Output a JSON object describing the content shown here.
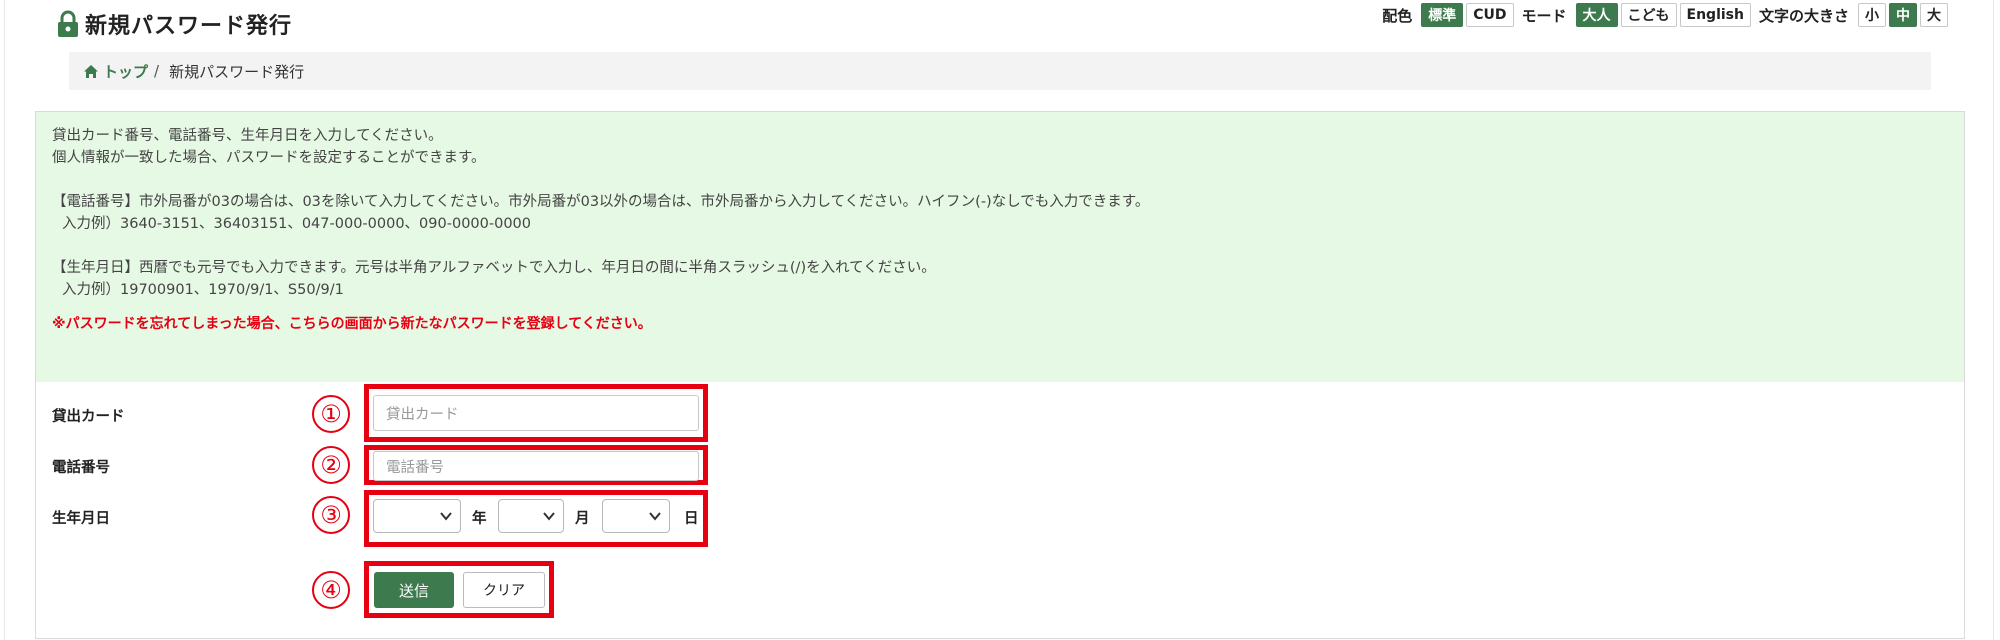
{
  "header": {
    "title": "新規パスワード発行",
    "color_label": "配色",
    "color_options": [
      "標準",
      "CUD"
    ],
    "mode_label": "モード",
    "mode_options": [
      "大人",
      "こども",
      "English"
    ],
    "size_label": "文字の大きさ",
    "size_options": [
      "小",
      "中",
      "大"
    ],
    "active": {
      "color": "標準",
      "mode": "大人",
      "size": "中"
    }
  },
  "breadcrumb": {
    "home": "トップ",
    "separator": "/",
    "current": "新規パスワード発行"
  },
  "notice": {
    "line1": "貸出カード番号、電話番号、生年月日を入力してください。",
    "line2": "個人情報が一致した場合、パスワードを設定することができます。",
    "phone_rule": "【電話番号】市外局番が03の場合は、03を除いて入力してください。市外局番が03以外の場合は、市外局番から入力してください。ハイフン(-)なしでも入力できます。",
    "phone_example": "入力例）3640-3151、36403151、047-000-0000、090-0000-0000",
    "birth_rule": "【生年月日】西暦でも元号でも入力できます。元号は半角アルファベットで入力し、年月日の間に半角スラッシュ(/)を入れてください。",
    "birth_example": "入力例）19700901、1970/9/1、S50/9/1",
    "warning": "※パスワードを忘れてしまった場合、こちらの画面から新たなパスワードを登録してください。"
  },
  "form": {
    "card_label": "貸出カード",
    "card_placeholder": "貸出カード",
    "phone_label": "電話番号",
    "phone_placeholder": "電話番号",
    "birth_label": "生年月日",
    "year_unit": "年",
    "month_unit": "月",
    "day_unit": "日",
    "submit_label": "送信",
    "clear_label": "クリア"
  },
  "annotations": [
    "①",
    "②",
    "③",
    "④"
  ],
  "colors": {
    "accent": "#3d7a4d",
    "notice_bg": "#e6f9e4",
    "highlight": "#e60012"
  }
}
